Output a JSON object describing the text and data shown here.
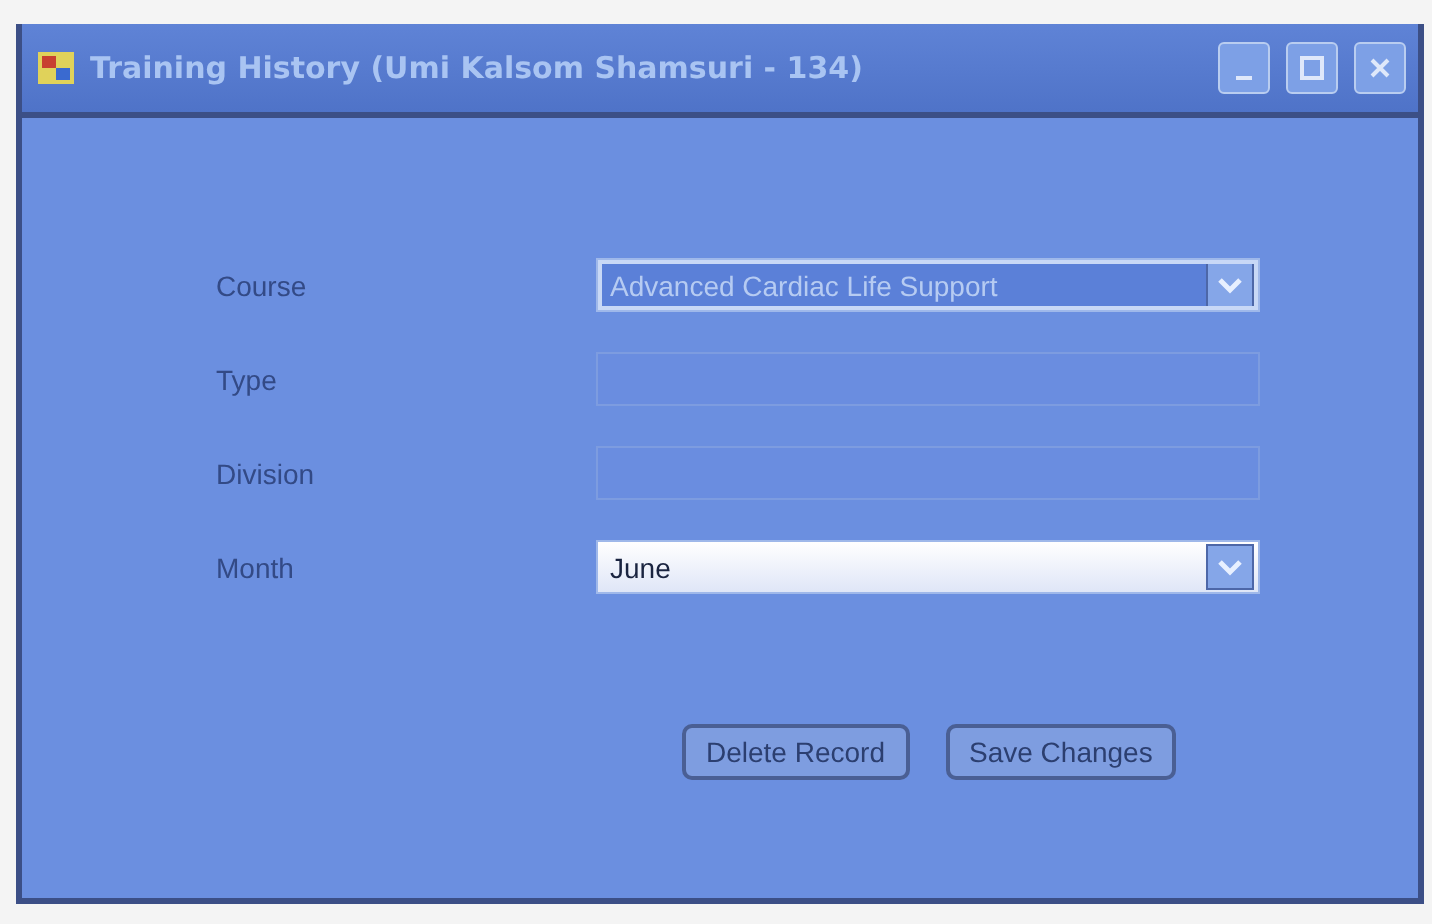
{
  "window": {
    "title": "Training History (Umi Kalsom Shamsuri - 134)"
  },
  "fields": [
    {
      "label": "Course",
      "kind": "combo",
      "value": "Advanced Cardiac Life Support",
      "focused": true,
      "disabled": false
    },
    {
      "label": "Type",
      "kind": "text",
      "disabled": true
    },
    {
      "label": "Division",
      "kind": "text",
      "disabled": true
    },
    {
      "label": "Month",
      "kind": "combo",
      "value": "June",
      "focused": false,
      "disabled": false
    }
  ],
  "buttons": [
    "Delete Record",
    "Save Changes"
  ]
}
